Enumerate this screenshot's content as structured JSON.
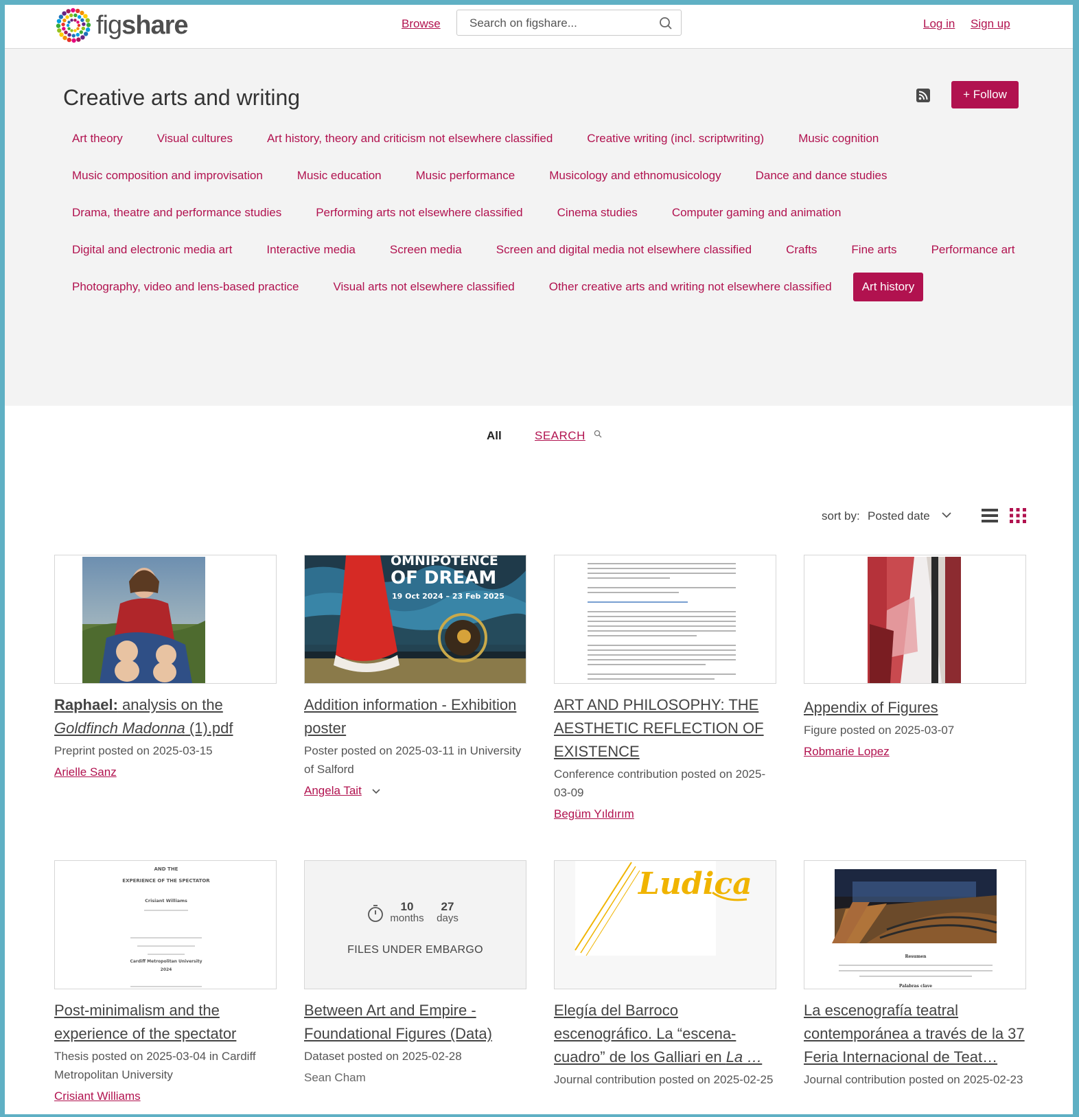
{
  "header": {
    "logo_text_light": "fig",
    "logo_text_bold": "share",
    "browse": "Browse",
    "search_placeholder": "Search on figshare...",
    "login": "Log in",
    "signup": "Sign up"
  },
  "category": {
    "title": "Creative arts and writing",
    "follow": "+ Follow",
    "tags": [
      "Art theory",
      "Visual cultures",
      "Art history, theory and criticism not elsewhere classified",
      "Creative writing (incl. scriptwriting)",
      "Music cognition",
      "Music composition and improvisation",
      "Music education",
      "Music performance",
      "Musicology and ethnomusicology",
      "Dance and dance studies",
      "Drama, theatre and performance studies",
      "Performing arts not elsewhere classified",
      "Cinema studies",
      "Computer gaming and animation",
      "Digital and electronic media art",
      "Interactive media",
      "Screen media",
      "Screen and digital media not elsewhere classified",
      "Crafts",
      "Fine arts",
      "Performance art",
      "Photography, video and lens-based practice",
      "Visual arts not elsewhere classified",
      "Other creative arts and writing not elsewhere classified",
      "Art history"
    ],
    "active_tag": "Art history"
  },
  "tabs": {
    "all": "All",
    "search": "SEARCH"
  },
  "sort": {
    "label": "sort by:",
    "value": "Posted date"
  },
  "cards": [
    {
      "title_bold": "Raphael:",
      "title_rest": " analysis on the ",
      "title_italic": "Goldfinch Madonna",
      "title_end": " (1).pdf",
      "meta": "Preprint posted on 2025-03-15",
      "author": "Arielle Sanz"
    },
    {
      "title": "Addition information - Exhibition poster",
      "meta": "Poster posted on 2025-03-11 in University of Salford",
      "author": "Angela Tait",
      "poster_line1": "OMNIPOTENCE",
      "poster_line2": "OF DREAM",
      "poster_dates": "19 Oct 2024 – 23 Feb 2025"
    },
    {
      "title": "ART AND PHILOSOPHY: THE AESTHETIC REFLECTION OF EXISTENCE",
      "meta": "Conference contribution posted on 2025-03-09",
      "author": "Begüm Yıldırım"
    },
    {
      "title": "Appendix of Figures",
      "meta": "Figure posted on 2025-03-07",
      "author": "Robmarie Lopez"
    },
    {
      "title": "Post-minimalism and the experience of the spectator",
      "meta": "Thesis posted on 2025-03-04 in Cardiff Metropolitan University",
      "author": "Crisiant Williams",
      "thumb_line1": "AND THE",
      "thumb_line2": "EXPERIENCE OF THE SPECTATOR",
      "thumb_name": "Crisiant Williams",
      "thumb_uni": "Cardiff Metropolitan University",
      "thumb_year": "2024"
    },
    {
      "title": "Between Art and Empire - Foundational Figures (Data)",
      "meta": "Dataset posted on 2025-02-28",
      "author": "Sean Cham",
      "embargo_months": "10",
      "embargo_months_label": "months",
      "embargo_days": "27",
      "embargo_days_label": "days",
      "embargo_text": "FILES UNDER EMBARGO"
    },
    {
      "title_main": "Elegía del Barroco escenográfico. La “escena-cuadro” de los Galliari en ",
      "title_italic": "La …",
      "meta": "Journal contribution posted on 2025-02-25",
      "author": "",
      "thumb_word": "Ludica"
    },
    {
      "title": "La escenografía teatral contemporánea a través de la 37 Feria Internacional de Teat…",
      "meta": "Journal contribution posted on 2025-02-23",
      "author": "",
      "thumb_heading": "Resumen",
      "thumb_footer": "Palabras clave"
    }
  ],
  "colors": {
    "accent": "#b1124f",
    "band": "#f3f3f3",
    "frame": "#5fb0c4"
  }
}
